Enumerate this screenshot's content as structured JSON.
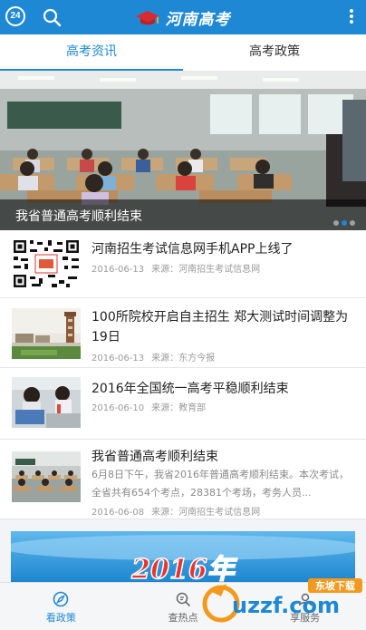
{
  "header": {
    "badge_text": "24",
    "app_title": "河南高考",
    "brand_color": "#1e88d4"
  },
  "tabs": [
    {
      "label": "高考资讯",
      "active": true
    },
    {
      "label": "高考政策",
      "active": false
    }
  ],
  "banner": {
    "caption": "我省普通高考顺利结束",
    "slide_count": 3,
    "active_slide": 2
  },
  "news": [
    {
      "title": "河南招生考试信息网手机APP上线了",
      "date": "2016-06-13",
      "source": "来源：河南招生考试信息网"
    },
    {
      "title": "100所院校开启自主招生 郑大测试时间调整为19日",
      "date": "2016-06-13",
      "source": "来源：东方今报"
    },
    {
      "title": "2016年全国统一高考平稳顺利结束",
      "date": "2016-06-10",
      "source": "来源：教育部"
    },
    {
      "title": "我省普通高考顺利结束",
      "summary": "6月8日下午，我省2016年普通高考顺利结束。本次考试，全省共有654个考点，28381个考场，考务人员...",
      "date": "2016-06-08",
      "source": "来源：河南招生考试信息网"
    }
  ],
  "promo": {
    "text": "2016年"
  },
  "bottom_nav": [
    {
      "label": "看政策",
      "icon": "compass-icon",
      "active": true
    },
    {
      "label": "查热点",
      "icon": "search-icon",
      "active": false
    },
    {
      "label": "享服务",
      "icon": "service-icon",
      "active": false
    }
  ],
  "watermark": {
    "brand": "uzzf.com",
    "sub": "东坡下载"
  }
}
